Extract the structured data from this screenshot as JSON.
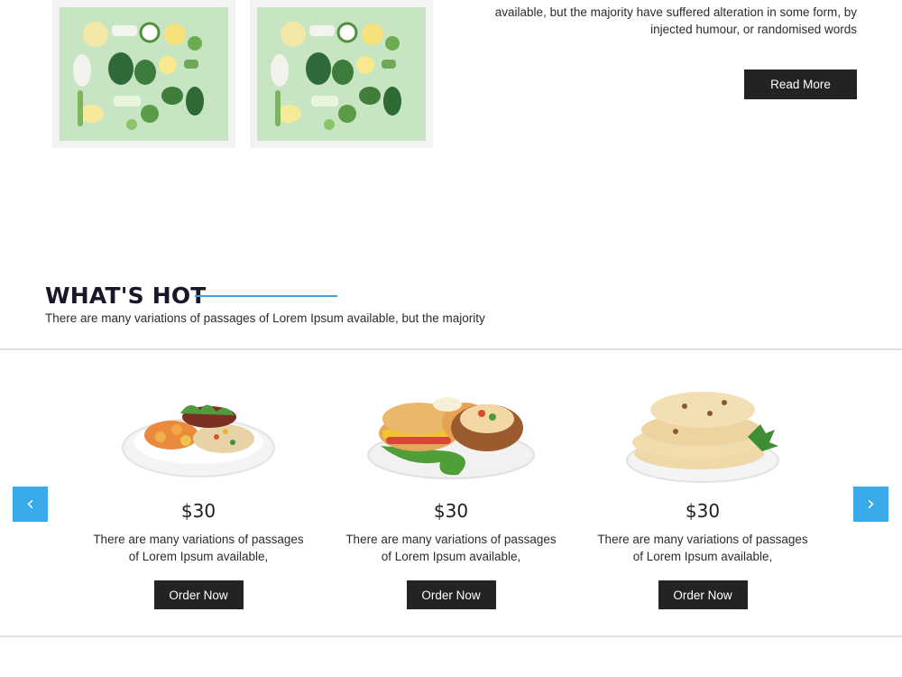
{
  "about": {
    "text": "available, but the majority have suffered alteration in some form, by injected humour, or randomised words",
    "read_more_label": "Read More"
  },
  "whats_hot": {
    "title": "WHAT'S HOT",
    "subtitle": "There are many variations of passages of Lorem Ipsum available, but the majority",
    "accent_color": "#39a3e4",
    "prev_label": "‹",
    "next_label": "›",
    "products": [
      {
        "price": "$30",
        "description": "There are many variations of passages of Lorem Ipsum available,",
        "order_label": "Order Now"
      },
      {
        "price": "$30",
        "description": "There are many variations of passages of Lorem Ipsum available,",
        "order_label": "Order Now"
      },
      {
        "price": "$30",
        "description": "There are many variations of passages of Lorem Ipsum available,",
        "order_label": "Order Now"
      }
    ]
  }
}
